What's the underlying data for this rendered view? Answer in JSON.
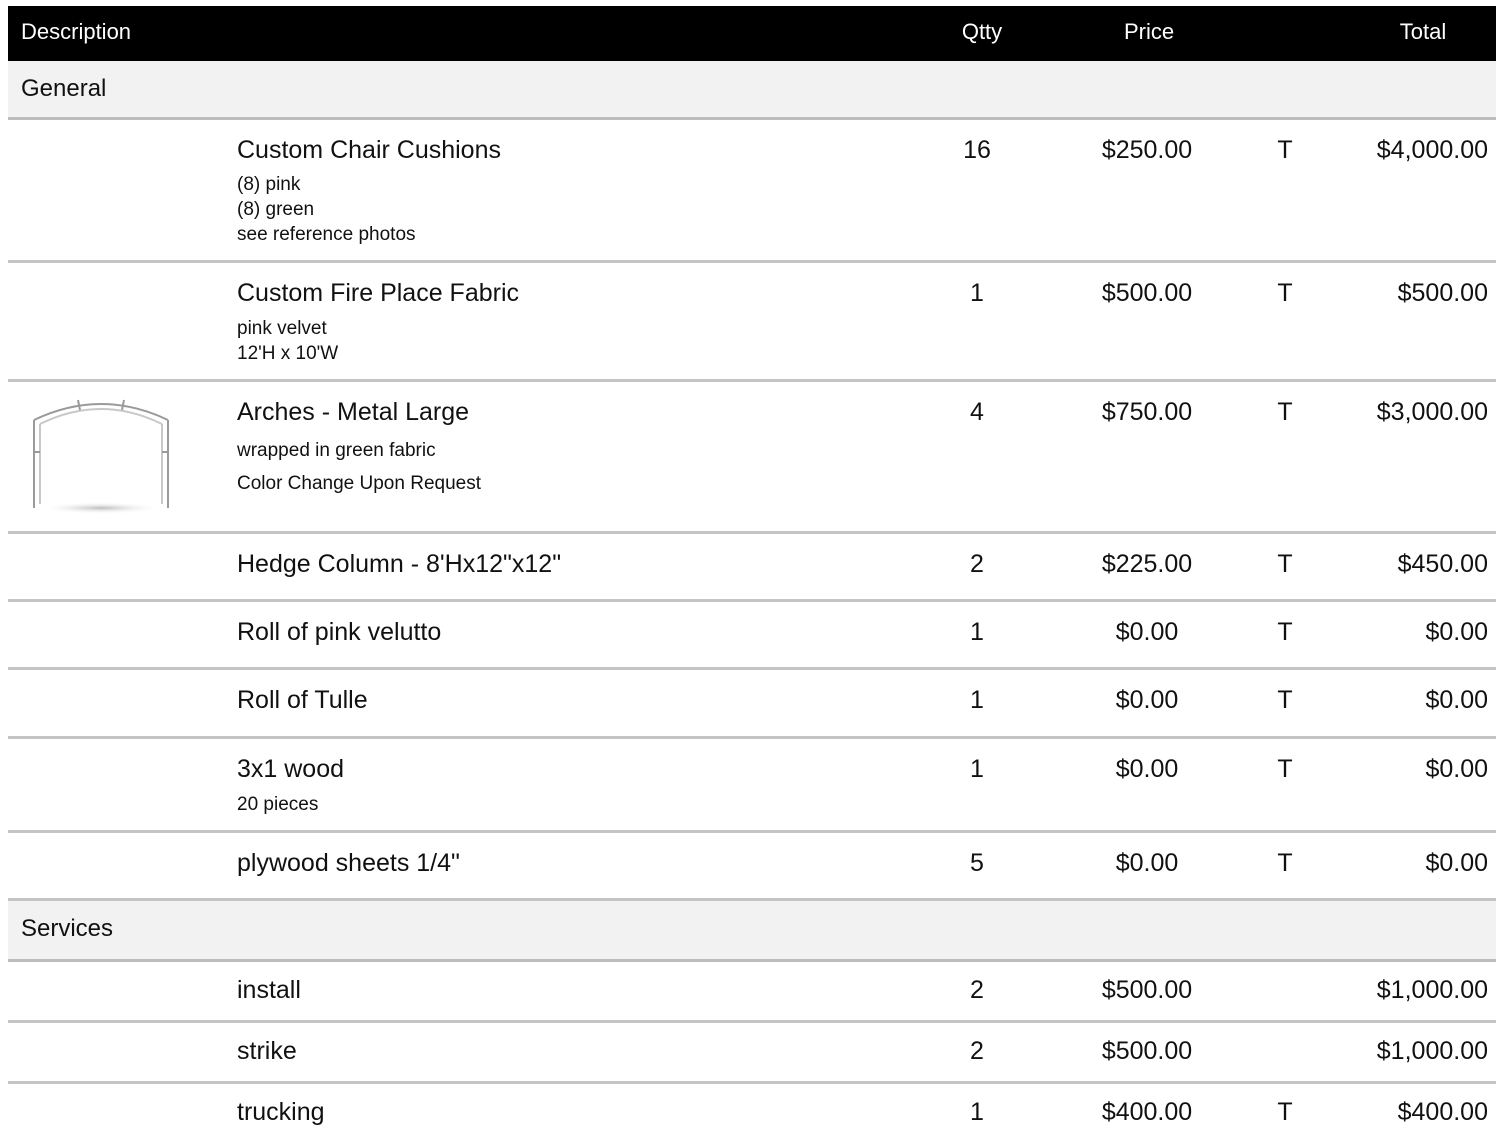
{
  "header": {
    "description": "Description",
    "qtty": "Qtty",
    "price": "Price",
    "total": "Total"
  },
  "sections": [
    {
      "title": "General"
    },
    {
      "title": "Services"
    }
  ],
  "items": [
    {
      "name": "Custom Chair Cushions",
      "notes": [
        "(8) pink",
        "(8) green",
        "see reference photos"
      ],
      "qty": "16",
      "price": "$250.00",
      "tax": "T",
      "total": "$4,000.00"
    },
    {
      "name": "Custom Fire Place Fabric",
      "notes": [
        "pink velvet",
        "12'H x 10'W"
      ],
      "qty": "1",
      "price": "$500.00",
      "tax": "T",
      "total": "$500.00"
    },
    {
      "name": "Arches - Metal Large",
      "notes": [
        "wrapped in green fabric",
        "Color Change Upon Request"
      ],
      "qty": "4",
      "price": "$750.00",
      "tax": "T",
      "total": "$3,000.00",
      "thumbnail": "metal-arch-image"
    },
    {
      "name": "Hedge Column - 8'Hx12\"x12\"",
      "notes": [],
      "qty": "2",
      "price": "$225.00",
      "tax": "T",
      "total": "$450.00"
    },
    {
      "name": "Roll of pink velutto",
      "notes": [],
      "qty": "1",
      "price": "$0.00",
      "tax": "T",
      "total": "$0.00"
    },
    {
      "name": "Roll of Tulle",
      "notes": [],
      "qty": "1",
      "price": "$0.00",
      "tax": "T",
      "total": "$0.00"
    },
    {
      "name": "3x1 wood",
      "notes": [
        "20 pieces"
      ],
      "qty": "1",
      "price": "$0.00",
      "tax": "T",
      "total": "$0.00"
    },
    {
      "name": "plywood sheets 1/4\"",
      "notes": [],
      "qty": "5",
      "price": "$0.00",
      "tax": "T",
      "total": "$0.00"
    },
    {
      "name": "install",
      "notes": [],
      "qty": "2",
      "price": "$500.00",
      "tax": "",
      "total": "$1,000.00"
    },
    {
      "name": "strike",
      "notes": [],
      "qty": "2",
      "price": "$500.00",
      "tax": "",
      "total": "$1,000.00"
    },
    {
      "name": "trucking",
      "notes": [],
      "qty": "1",
      "price": "$400.00",
      "tax": "T",
      "total": "$400.00"
    }
  ]
}
